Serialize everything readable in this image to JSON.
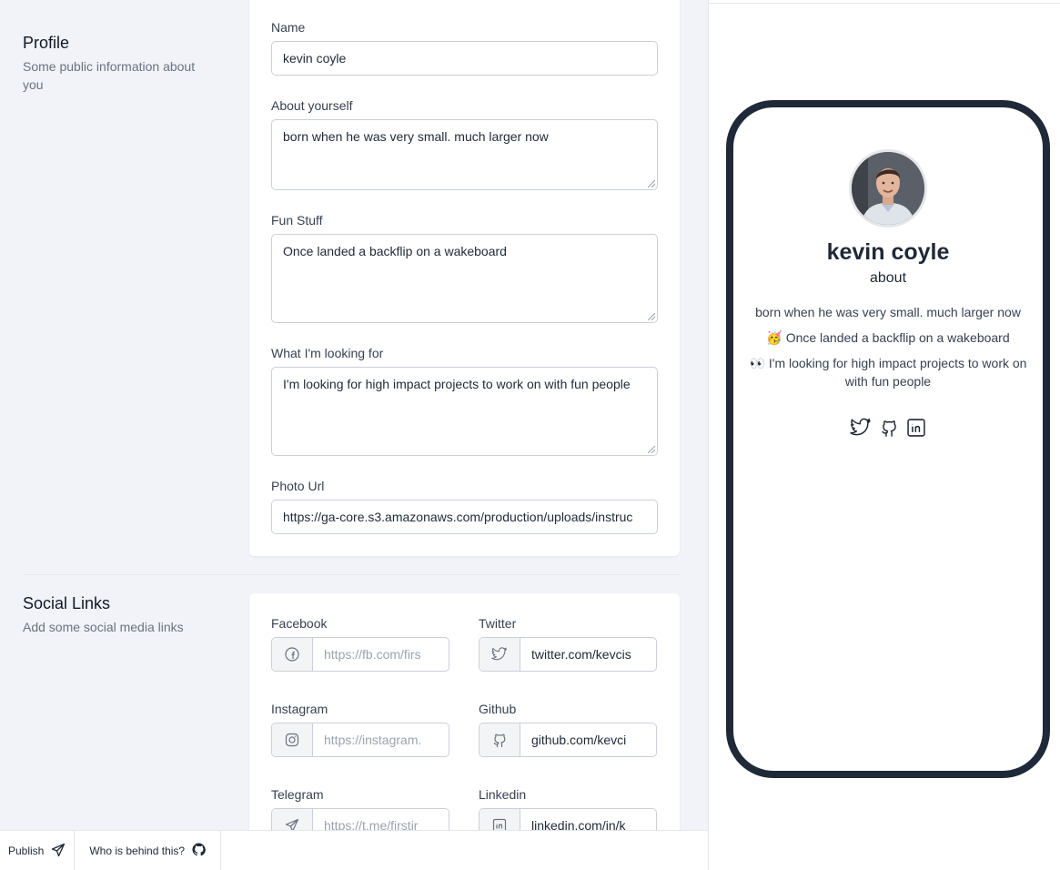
{
  "profile_section": {
    "title": "Profile",
    "description": "Some public information about you"
  },
  "profile_form": {
    "name": {
      "label": "Name",
      "value": "kevin coyle"
    },
    "about": {
      "label": "About yourself",
      "value": "born when he was very small. much larger now"
    },
    "fun": {
      "label": "Fun Stuff",
      "value": "Once landed a backflip on a wakeboard"
    },
    "looking": {
      "label": "What I'm looking for",
      "value": "I'm looking for high impact projects to work on with fun people"
    },
    "photo": {
      "label": "Photo Url",
      "value": "https://ga-core.s3.amazonaws.com/production/uploads/instruc"
    }
  },
  "social_section": {
    "title": "Social Links",
    "description": "Add some social media links"
  },
  "social_form": {
    "facebook": {
      "label": "Facebook",
      "placeholder": "https://fb.com/firs",
      "icon": "facebook-icon"
    },
    "twitter": {
      "label": "Twitter",
      "value": "twitter.com/kevcis",
      "icon": "twitter-icon"
    },
    "instagram": {
      "label": "Instagram",
      "placeholder": "https://instagram.",
      "icon": "instagram-icon"
    },
    "github": {
      "label": "Github",
      "value": "github.com/kevci",
      "icon": "github-icon"
    },
    "telegram": {
      "label": "Telegram",
      "placeholder": "https://t.me/firstir",
      "icon": "telegram-icon"
    },
    "linkedin": {
      "label": "Linkedin",
      "value": "linkedin.com/in/k",
      "icon": "linkedin-icon"
    }
  },
  "footer": {
    "publish_label": "Publish",
    "who_label": "Who is behind this?"
  },
  "preview": {
    "name": "kevin coyle",
    "about_heading": "about",
    "about_text": "born when he was very small. much larger now",
    "fun_emoji": "🥳",
    "fun_text": "Once landed a backflip on a wakeboard",
    "looking_emoji": "👀",
    "looking_text": "I'm looking for high impact projects to work on with fun people",
    "social_icons": [
      "twitter-icon",
      "github-icon",
      "linkedin-icon"
    ]
  },
  "colors": {
    "editor_bg": "#f1f3f8",
    "phone_frame": "#1f2937",
    "text_primary": "#1f2937",
    "text_muted": "#6b7280"
  }
}
